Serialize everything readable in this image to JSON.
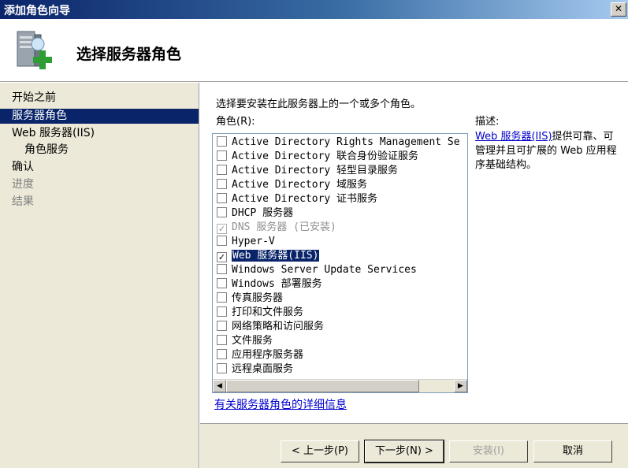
{
  "window": {
    "title": "添加角色向导",
    "close_glyph": "✕"
  },
  "header": {
    "title": "选择服务器角色",
    "icon": "server-add-icon"
  },
  "sidebar": {
    "steps": [
      {
        "label": "开始之前",
        "state": "normal"
      },
      {
        "label": "服务器角色",
        "state": "active"
      },
      {
        "label": "Web 服务器(IIS)",
        "state": "normal"
      },
      {
        "label": "角色服务",
        "state": "sub"
      },
      {
        "label": "确认",
        "state": "normal"
      },
      {
        "label": "进度",
        "state": "disabled"
      },
      {
        "label": "结果",
        "state": "disabled"
      }
    ]
  },
  "main": {
    "prompt": "选择要安装在此服务器上的一个或多个角色。",
    "roles_label": "角色(R):",
    "roles": [
      {
        "label": "Active Directory Rights Management Se",
        "checked": false,
        "disabled": false
      },
      {
        "label": "Active Directory 联合身份验证服务",
        "checked": false,
        "disabled": false
      },
      {
        "label": "Active Directory 轻型目录服务",
        "checked": false,
        "disabled": false
      },
      {
        "label": "Active Directory 域服务",
        "checked": false,
        "disabled": false
      },
      {
        "label": "Active Directory 证书服务",
        "checked": false,
        "disabled": false
      },
      {
        "label": "DHCP 服务器",
        "checked": false,
        "disabled": false
      },
      {
        "label": "DNS 服务器  (已安装)",
        "checked": true,
        "disabled": true
      },
      {
        "label": "Hyper-V",
        "checked": false,
        "disabled": false
      },
      {
        "label": "Web 服务器(IIS)",
        "checked": true,
        "disabled": false,
        "selected": true
      },
      {
        "label": "Windows Server Update Services",
        "checked": false,
        "disabled": false
      },
      {
        "label": "Windows 部署服务",
        "checked": false,
        "disabled": false
      },
      {
        "label": "传真服务器",
        "checked": false,
        "disabled": false
      },
      {
        "label": "打印和文件服务",
        "checked": false,
        "disabled": false
      },
      {
        "label": "网络策略和访问服务",
        "checked": false,
        "disabled": false
      },
      {
        "label": "文件服务",
        "checked": false,
        "disabled": false
      },
      {
        "label": "应用程序服务器",
        "checked": false,
        "disabled": false
      },
      {
        "label": "远程桌面服务",
        "checked": false,
        "disabled": false
      }
    ],
    "scroll_left": "◀",
    "scroll_right": "▶",
    "more_info_link": "有关服务器角色的详细信息",
    "description": {
      "label": "描述:",
      "link": "Web 服务器(IIS)",
      "text": "提供可靠、可管理并且可扩展的 Web 应用程序基础结构。"
    }
  },
  "footer": {
    "back": "< 上一步(P)",
    "next": "下一步(N) >",
    "install": "安装(I)",
    "cancel": "取消"
  },
  "colors": {
    "selection": "#0a246a",
    "link": "#0000cc",
    "panel": "#ece9d8"
  }
}
